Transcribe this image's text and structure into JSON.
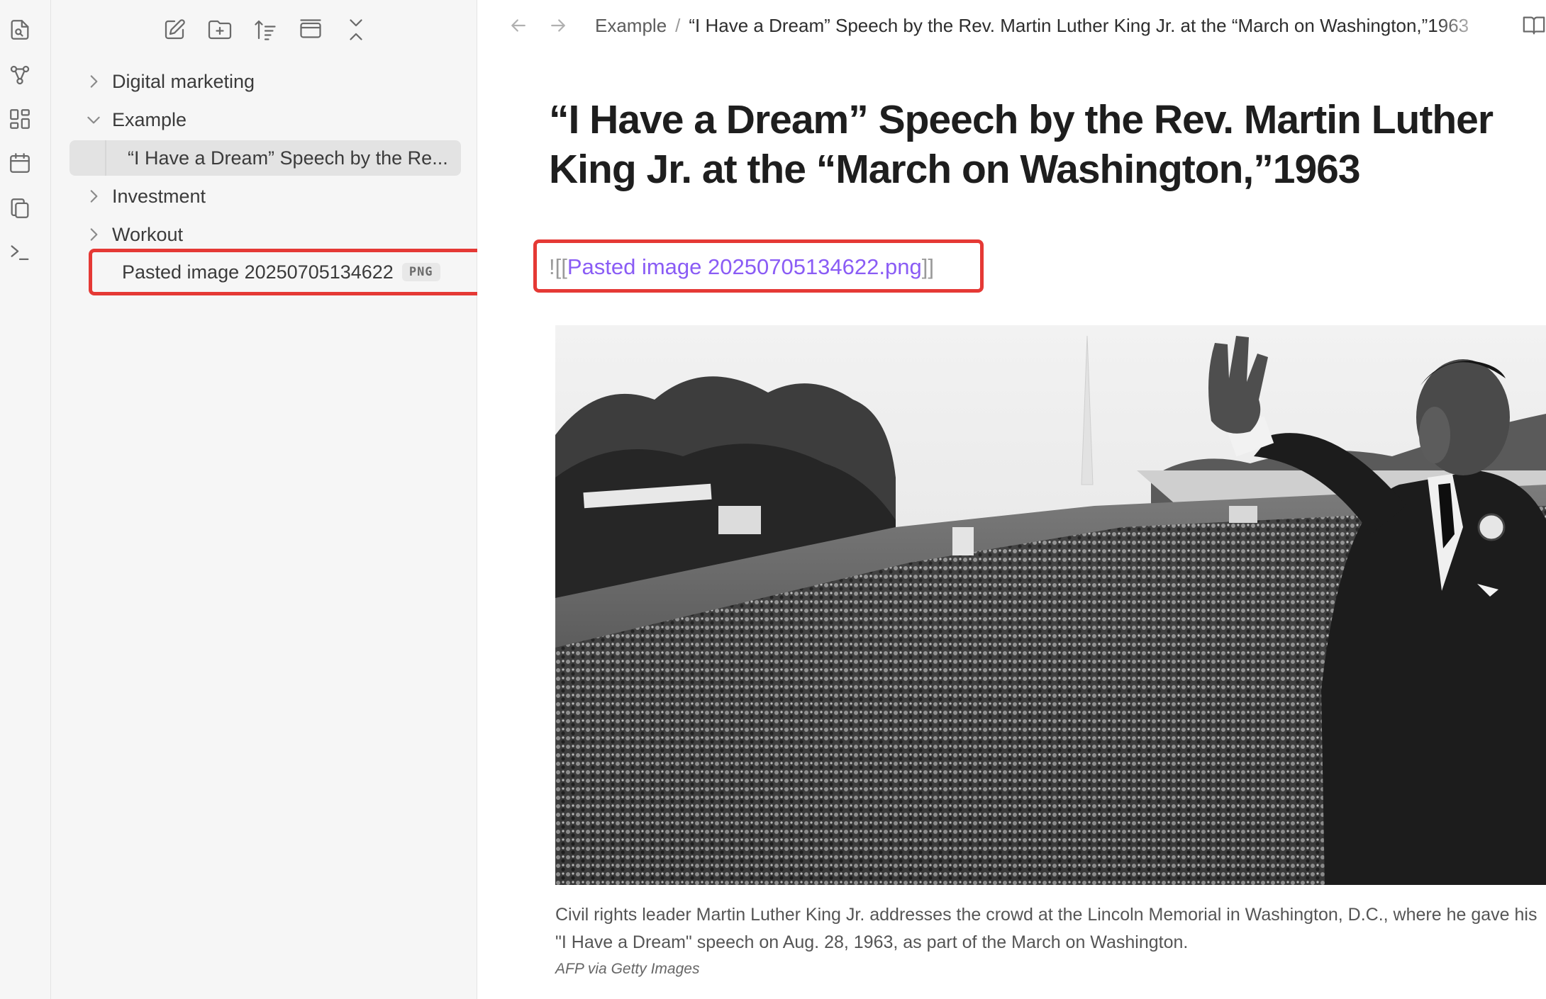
{
  "ribbon": {
    "icons": [
      "open-quick-switcher-icon",
      "graph-view-icon",
      "canvas-icon",
      "daily-note-icon",
      "templates-icon",
      "command-palette-icon"
    ]
  },
  "sidebar": {
    "toolbar_icons": [
      "new-note-icon",
      "new-folder-icon",
      "sort-icon",
      "auto-reveal-icon",
      "collapse-all-icon"
    ],
    "items": [
      {
        "label": "Digital marketing",
        "type": "folder",
        "expanded": false
      },
      {
        "label": "Example",
        "type": "folder",
        "expanded": true
      },
      {
        "label": "“I Have a Dream” Speech by the Re...",
        "type": "note",
        "selected": true
      },
      {
        "label": "Investment",
        "type": "folder",
        "expanded": false
      },
      {
        "label": "Workout",
        "type": "folder",
        "expanded": false
      },
      {
        "label": "Pasted image 20250705134622",
        "type": "attachment",
        "badge": "PNG",
        "highlighted": true
      }
    ]
  },
  "header": {
    "breadcrumb_folder": "Example",
    "breadcrumb_separator": "/",
    "breadcrumb_note": "“I Have a Dream” Speech by the Rev. Martin Luther King Jr. at the “March on Washington,”1963"
  },
  "note": {
    "title": "“I Have a Dream” Speech by the Rev. Martin Luther King Jr. at the “March on Washington,”1963",
    "embed_prefix": "![[",
    "embed_link": "Pasted image 20250705134622.png",
    "embed_suffix": "]]",
    "caption": "Civil rights leader Martin Luther King Jr. addresses the crowd at the Lincoln Memorial in Washington, D.C., where he gave his \"I Have a Dream\" speech on Aug. 28, 1963, as part of the March on Washington.",
    "credit": "AFP via Getty Images"
  },
  "colors": {
    "link": "#8a5cf5",
    "highlight_border": "#e53935",
    "sidebar_bg": "#f6f6f6",
    "selected_bg": "#e3e3e3"
  }
}
